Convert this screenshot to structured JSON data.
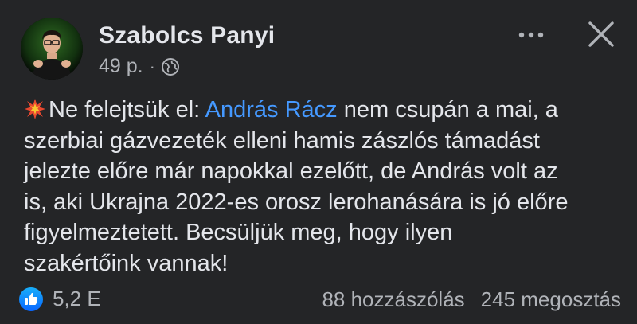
{
  "post": {
    "author": {
      "name": "Szabolcs Panyi",
      "avatar_icon": "profile-photo"
    },
    "time": "49 p.",
    "separator": "·",
    "privacy_icon": "globe-icon",
    "more_icon": "more-dots-icon",
    "close_icon": "close-icon",
    "text": {
      "emoji": "collision-emoji",
      "line1_before": "Ne felejtsük el: ",
      "mention": "András Rácz",
      "line1_after": " nem csupán a mai, a",
      "line2": "szerbiai gázvezeték elleni hamis zászlós támadást",
      "line3": "jelezte előre már napokkal ezelőtt, de András volt az",
      "line4": "is, aki Ukrajna 2022-es orosz lerohanására is jó előre",
      "line5": "figyelmeztetett. Becsüljük meg, hogy ilyen",
      "line6": "szakértőink vannak!"
    },
    "footer": {
      "like_icon": "like-icon",
      "reactions": "5,2 E",
      "comments": "88 hozzászólás",
      "shares": "245 megosztás"
    }
  },
  "colors": {
    "background": "#242527",
    "text": "#e4e6eb",
    "secondary": "#b0b3b8",
    "mention": "#4599ff",
    "like_blue": "#1877f2"
  }
}
